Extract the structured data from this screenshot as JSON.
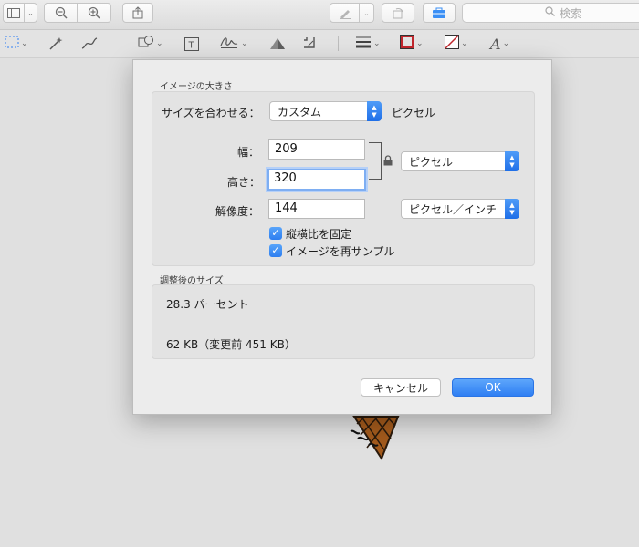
{
  "toolbar": {
    "search_placeholder": "検索"
  },
  "dialog": {
    "section1_title": "イメージの大きさ",
    "fit_label": "サイズを合わせる：",
    "fit_value": "カスタム",
    "fit_unit": "ピクセル",
    "width_label": "幅：",
    "width_value": "209",
    "height_label": "高さ：",
    "height_value": "320",
    "resolution_label": "解像度：",
    "resolution_value": "144",
    "size_unit_value": "ピクセル",
    "resolution_unit_value": "ピクセル／インチ",
    "checkbox_proportional": "縦横比を固定",
    "checkbox_resample": "イメージを再サンプル",
    "section2_title": "調整後のサイズ",
    "percent_text": "28.3 パーセント",
    "kb_text": "62 KB（変更前 451 KB）",
    "cancel_label": "キャンセル",
    "ok_label": "OK"
  },
  "colors": {
    "accent": "#2f7ff3",
    "border_swatch": "#c1272d",
    "cone": "#a35a1c"
  },
  "icons": [
    "sidebar-icon",
    "zoom-out-icon",
    "zoom-in-icon",
    "share-icon",
    "markup-pen-icon",
    "rotate-icon",
    "toolbox-icon",
    "search-icon",
    "selection-icon",
    "magic-wand-icon",
    "sketch-icon",
    "shapes-icon",
    "text-icon",
    "signature-icon",
    "adjust-color-icon",
    "crop-icon",
    "line-style-icon",
    "border-color-icon",
    "fill-color-icon",
    "text-style-icon",
    "lock-icon"
  ]
}
